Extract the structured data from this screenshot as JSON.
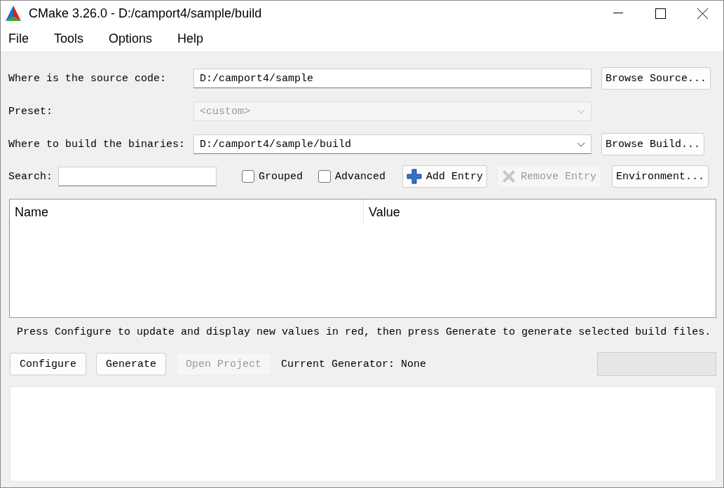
{
  "window": {
    "title": "CMake 3.26.0 - D:/camport4/sample/build"
  },
  "menu": [
    "File",
    "Tools",
    "Options",
    "Help"
  ],
  "fields": [
    {
      "kind": "text",
      "label": "Where is the source code:",
      "value": "D:/camport4/sample",
      "disabled": false,
      "button": "Browse Source..."
    },
    {
      "kind": "combo",
      "label": "Preset:",
      "value": "<custom>",
      "disabled": true
    },
    {
      "kind": "combo",
      "label": "Where to build the binaries:",
      "value": "D:/camport4/sample/build",
      "disabled": false,
      "button": "Browse Build..."
    }
  ],
  "search": {
    "label": "Search:"
  },
  "options": [
    {
      "label": "Grouped",
      "checked": false
    },
    {
      "label": "Advanced",
      "checked": false
    }
  ],
  "entry_buttons": [
    {
      "kind": "add",
      "label": "Add Entry",
      "disabled": false
    },
    {
      "kind": "remove",
      "label": "Remove Entry",
      "disabled": true
    },
    {
      "kind": "plain",
      "label": "Environment...",
      "disabled": false
    }
  ],
  "table": {
    "columns": [
      "Name",
      "Value"
    ]
  },
  "hint": "Press Configure to update and display new values in red, then press Generate to generate selected build files.",
  "actions": [
    {
      "label": "Configure",
      "disabled": false
    },
    {
      "label": "Generate",
      "disabled": false
    },
    {
      "label": "Open Project",
      "disabled": true
    }
  ],
  "generator": "Current Generator: None",
  "progress": {
    "level": 0
  }
}
